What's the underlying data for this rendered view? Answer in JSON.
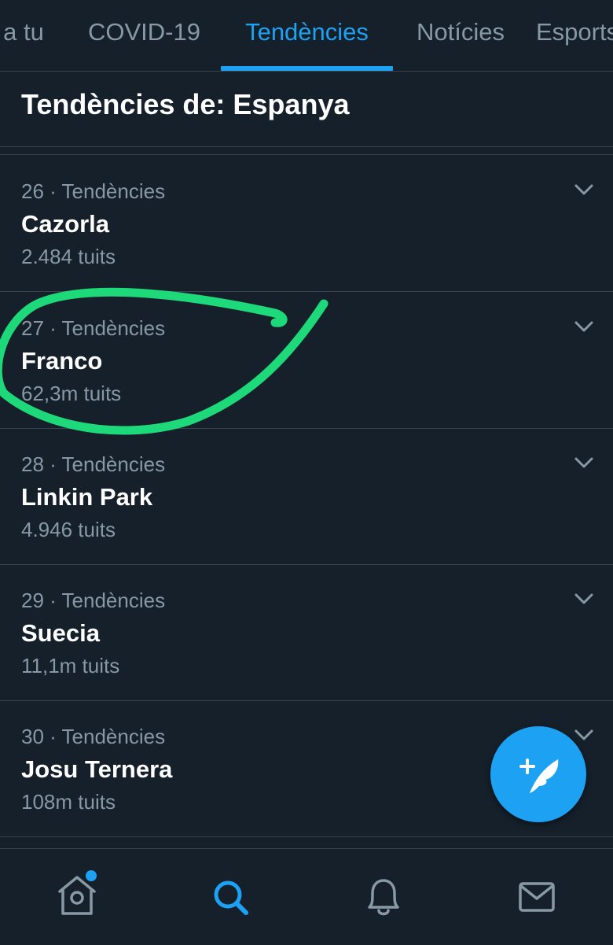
{
  "tabs": [
    {
      "label": "a tu"
    },
    {
      "label": "COVID-19"
    },
    {
      "label": "Tendències",
      "active": true
    },
    {
      "label": "Notícies"
    },
    {
      "label": "Esports"
    }
  ],
  "section_title": "Tendències de: Espanya",
  "trends": [
    {
      "meta": "26 · Tendències",
      "name": "Cazorla",
      "count": "2.484 tuits"
    },
    {
      "meta": "27 · Tendències",
      "name": "Franco",
      "count": "62,3m tuits"
    },
    {
      "meta": "28 · Tendències",
      "name": "Linkin Park",
      "count": "4.946 tuits"
    },
    {
      "meta": "29 · Tendències",
      "name": "Suecia",
      "count": "11,1m tuits"
    },
    {
      "meta": "30 · Tendències",
      "name": "Josu Ternera",
      "count": "108m tuits"
    }
  ],
  "annotation": {
    "color": "#1ed97a",
    "highlighted_trend": "Franco"
  },
  "fab": {
    "icon": "compose-tweet-icon",
    "color": "#1da1f2"
  },
  "bottom_nav": [
    {
      "icon": "home-icon",
      "has_notification_dot": true
    },
    {
      "icon": "search-icon",
      "active": true
    },
    {
      "icon": "notifications-bell-icon"
    },
    {
      "icon": "messages-envelope-icon"
    }
  ],
  "colors": {
    "background": "#15202b",
    "accent": "#1da1f2",
    "secondary_text": "#8899a6",
    "divider": "#38444d"
  }
}
